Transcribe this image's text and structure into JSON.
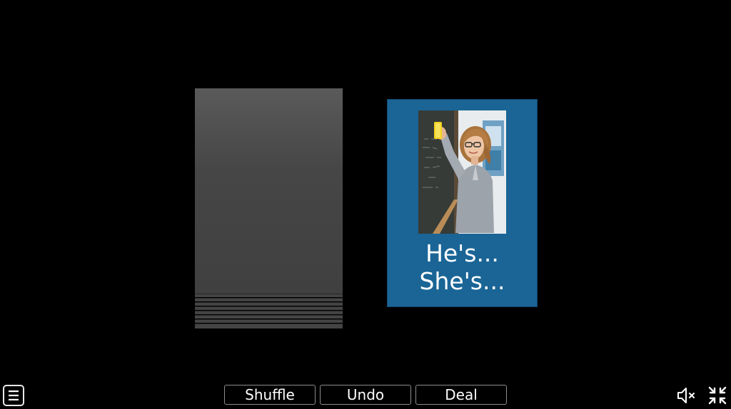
{
  "card": {
    "line1": "He's...",
    "line2": "She's...",
    "picture_icon": "teacher-at-chalkboard-photo",
    "background_color": "#1a6596"
  },
  "deck": {
    "icon": "card-stack-back",
    "color": "#444444"
  },
  "controls": {
    "shuffle_label": "Shuffle",
    "undo_label": "Undo",
    "deal_label": "Deal"
  },
  "icons": {
    "menu": "hamburger-menu-icon",
    "mute": "speaker-muted-icon",
    "fullscreen": "exit-fullscreen-icon"
  }
}
